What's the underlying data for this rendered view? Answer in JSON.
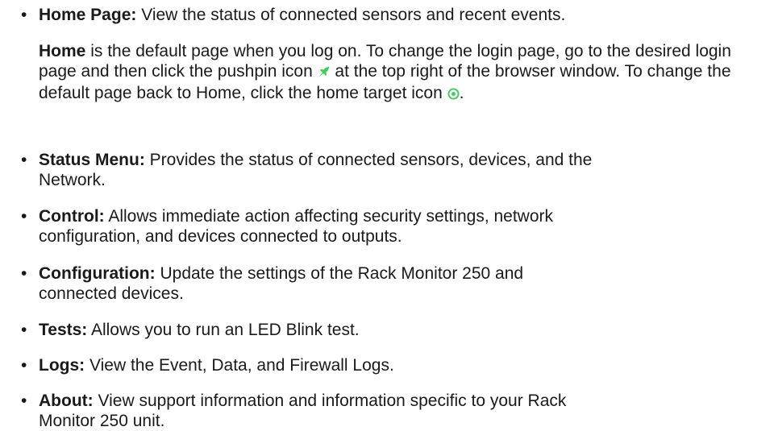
{
  "items": [
    {
      "term": "Home Page:",
      "desc": " View the status of connected sensors and recent events."
    },
    {
      "term": "Status Menu:",
      "desc": " Provides the status of connected sensors, devices, and the Network."
    },
    {
      "term": "Control:",
      "desc": " Allows immediate action affecting security settings, network configuration, and devices connected to outputs."
    },
    {
      "term": "Configuration:",
      "desc": " Update the settings of the Rack Monitor 250 and connected devices."
    },
    {
      "term": "Tests:",
      "desc": " Allows you to run an LED Blink test."
    },
    {
      "term": "Logs:",
      "desc": " View the Event, Data, and Firewall Logs."
    },
    {
      "term": "About:",
      "desc": " View support information and information specific to your Rack Monitor 250 unit."
    }
  ],
  "home_note": {
    "term": "Home",
    "text_a": " is the default page when you log on. To change the login page, go to the desired login page and then click the pushpin icon ",
    "text_b": " at the top right of the browser window. To change the default page back to Home, click the home target icon ",
    "text_c": "."
  },
  "bullet_char": "•",
  "icons": {
    "pushpin": "pushpin-icon",
    "home_target": "home-target-icon",
    "color": "#3dcd58"
  }
}
